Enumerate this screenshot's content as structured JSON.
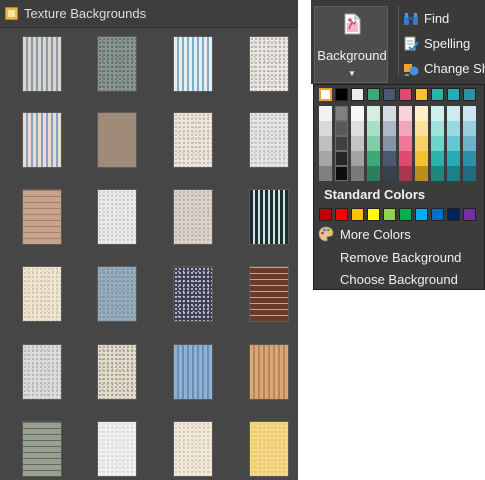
{
  "texture_panel": {
    "title": "Texture Backgrounds",
    "title_icon": "texture-folder-icon",
    "textures": [
      {
        "name": "texture-1",
        "base": "#d7d7d2",
        "pattern": "vstripes",
        "accent": "#8f97a2"
      },
      {
        "name": "texture-2",
        "base": "#8a9690",
        "pattern": "speckle",
        "accent": "#5f6a64"
      },
      {
        "name": "texture-3",
        "base": "#e6ecef",
        "pattern": "vstripes",
        "accent": "#7fb0c5"
      },
      {
        "name": "texture-4",
        "base": "#e9e7e2",
        "pattern": "speckle",
        "accent": "#b0aca2"
      },
      {
        "name": "texture-5",
        "base": "#e9dccd",
        "pattern": "vstripes",
        "accent": "#8aa0c4"
      },
      {
        "name": "texture-6",
        "base": "#a08a78",
        "pattern": "plain",
        "accent": "#8c7563"
      },
      {
        "name": "texture-7",
        "base": "#ece6dd",
        "pattern": "speckle",
        "accent": "#c5b7a5"
      },
      {
        "name": "texture-8",
        "base": "#e5e5e4",
        "pattern": "speckle",
        "accent": "#bdbdbb"
      },
      {
        "name": "texture-9",
        "base": "#c8a38b",
        "pattern": "hlines",
        "accent": "#a4826b"
      },
      {
        "name": "texture-10",
        "base": "#ebebeb",
        "pattern": "speckle",
        "accent": "#c9c9c9"
      },
      {
        "name": "texture-11",
        "base": "#dcd4cc",
        "pattern": "speckle",
        "accent": "#bbb1a7"
      },
      {
        "name": "texture-12",
        "base": "#1d2c2e",
        "pattern": "vstripes",
        "accent": "#cfe5e2"
      },
      {
        "name": "texture-13",
        "base": "#efe5d3",
        "pattern": "speckle",
        "accent": "#d2c3a8"
      },
      {
        "name": "texture-14",
        "base": "#96adbd",
        "pattern": "speckle",
        "accent": "#7b93a4"
      },
      {
        "name": "texture-15",
        "base": "#3d3e50",
        "pattern": "speckle",
        "accent": "#c9c9d8"
      },
      {
        "name": "texture-16",
        "base": "#6b3b2a",
        "pattern": "hlines",
        "accent": "#c4a190"
      },
      {
        "name": "texture-17",
        "base": "#dcdcdc",
        "pattern": "speckle",
        "accent": "#b4b4b4"
      },
      {
        "name": "texture-18",
        "base": "#e2ddd0",
        "pattern": "speckle",
        "accent": "#a49c86"
      },
      {
        "name": "texture-19",
        "base": "#8eb2d4",
        "pattern": "vstripes",
        "accent": "#6a8eb3"
      },
      {
        "name": "texture-20",
        "base": "#d9a876",
        "pattern": "vstripes",
        "accent": "#b98552"
      },
      {
        "name": "texture-21",
        "base": "#9aa08f",
        "pattern": "hlines",
        "accent": "#5d6d66"
      },
      {
        "name": "texture-22",
        "base": "#f1f1ef",
        "pattern": "speckle",
        "accent": "#d8d8d6"
      },
      {
        "name": "texture-23",
        "base": "#f1eadb",
        "pattern": "speckle",
        "accent": "#d5c9b0"
      },
      {
        "name": "texture-24",
        "base": "#f7d98c",
        "pattern": "speckle",
        "accent": "#e8c164"
      }
    ]
  },
  "ribbon": {
    "background_button": {
      "label": "Background",
      "icon": "background-paint-icon",
      "chevron": "chevron-down-icon"
    },
    "items": [
      {
        "name": "find-button",
        "icon": "binoculars-icon",
        "label": "Find"
      },
      {
        "name": "spelling-button",
        "icon": "spell-check-icon",
        "label": "Spelling"
      },
      {
        "name": "change-shape-button",
        "icon": "change-shape-icon",
        "label": "Change Sh"
      }
    ]
  },
  "dropdown": {
    "theme_colors": [
      "#ffffff",
      "#000000",
      "#ececec",
      "#3ea87b",
      "#4a5a6e",
      "#e04a70",
      "#f5c033",
      "#2ab3a6",
      "#27a9b6",
      "#2d8fa8"
    ],
    "theme_shades": [
      [
        "#f2f2f2",
        "#d9d9d9",
        "#bfbfbf",
        "#a6a6a6",
        "#808080"
      ],
      [
        "#7f7f7f",
        "#595959",
        "#404040",
        "#262626",
        "#0d0d0d"
      ],
      [
        "#f7f7f7",
        "#dedede",
        "#c4c4c4",
        "#a3a3a3",
        "#7a7a7a"
      ],
      [
        "#d4efe2",
        "#a9dfc5",
        "#7ecfa8",
        "#3ea87b",
        "#2e7d5c"
      ],
      [
        "#d6dbe2",
        "#adb7c5",
        "#8593a8",
        "#4a5a6e",
        "#36424f"
      ],
      [
        "#f9d2dd",
        "#f3a5bb",
        "#ed7899",
        "#e04a70",
        "#a9374f"
      ],
      [
        "#fdf0cb",
        "#fbe19a",
        "#f9d066",
        "#f5c033",
        "#b98f20"
      ],
      [
        "#cff1ee",
        "#9fe3dc",
        "#6fd5ca",
        "#2ab3a6",
        "#1f877c"
      ],
      [
        "#ccecf0",
        "#99d9e2",
        "#66c7d3",
        "#27a9b6",
        "#1d7f89"
      ],
      [
        "#cde6ee",
        "#9bcddc",
        "#6ab5cb",
        "#2d8fa8",
        "#216b7e"
      ]
    ],
    "standard_colors_label": "Standard Colors",
    "standard_colors": [
      "#c00000",
      "#ff0000",
      "#ffc000",
      "#ffff00",
      "#92d050",
      "#00b050",
      "#00b0f0",
      "#0070c0",
      "#002060",
      "#7030a0"
    ],
    "more_colors_label": "More Colors",
    "more_colors_icon": "color-palette-icon",
    "remove_background_label": "Remove Background",
    "choose_background_label": "Choose Background"
  }
}
